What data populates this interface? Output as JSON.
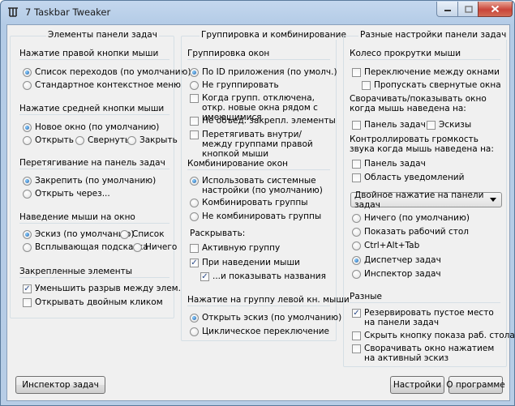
{
  "window": {
    "title": "7 Taskbar Tweaker"
  },
  "col1": {
    "title": "Элементы панели задач",
    "right_click": {
      "label": "Нажатие правой кнопки мыши",
      "opt1": "Список переходов (по умолчанию)",
      "opt2": "Стандартное контекстное меню"
    },
    "middle_click": {
      "label": "Нажатие средней кнопки мыши",
      "opt1": "Новое окно (по умолчанию)",
      "opt2": "Открыть",
      "opt3": "Свернуть",
      "opt4": "Закрыть"
    },
    "drag": {
      "label": "Перетягивание на панель задач",
      "opt1": "Закрепить (по умолчанию)",
      "opt2": "Открыть через..."
    },
    "hover": {
      "label": "Наведение мыши на окно",
      "opt1": "Эскиз (по умолчанию)",
      "opt2": "Список",
      "opt3": "Всплывающая подсказка",
      "opt4": "Ничего"
    },
    "pinned": {
      "label": "Закрепленные элементы",
      "chk1": "Уменьшить разрыв между элем.",
      "chk2": "Открывать двойным кликом"
    }
  },
  "col2": {
    "title": "Группировка и комбинирование",
    "grouping": {
      "label": "Группировка окон",
      "opt1": "По ID приложения (по умолч.)",
      "opt2": "Не группировать",
      "chk1": "Когда групп. отключена, откр. новые окна рядом с имеющимися",
      "chk2": "Не объед. закрепл. элементы",
      "chk3": "Перетягивать внутри/между группами правой кнопкой мыши"
    },
    "combining": {
      "label": "Комбинирование окон",
      "opt1": "Использовать системные настройки (по умолчанию)",
      "opt2": "Комбинировать группы",
      "opt3": "Не комбинировать группы",
      "expand_label": "Раскрывать:",
      "chk1": "Активную группу",
      "chk2": "При наведении мыши",
      "chk3": "...и показывать названия"
    },
    "left_click": {
      "label": "Нажатие на группу левой кн. мыши",
      "opt1": "Открыть эскиз (по умолчанию)",
      "opt2": "Циклическое переключение"
    }
  },
  "col3": {
    "title": "Разные настройки панели задач",
    "wheel": {
      "label": "Колесо прокрутки мыши",
      "chk1": "Переключение между окнами",
      "chk2": "Пропускать свернутые окна"
    },
    "minimize_hover": {
      "label": "Сворачивать/показывать окно когда мышь наведена на:",
      "chk1": "Панель задач",
      "chk2": "Эскизы"
    },
    "volume_hover": {
      "label": "Контроллировать громкость звука когда мышь наведена на:",
      "chk1": "Панель задач",
      "chk2": "Область уведомлений"
    },
    "double_click": {
      "selected": "Двойное нажатие на панели задач",
      "opt1": "Ничего (по умолчанию)",
      "opt2": "Показать рабочий стол",
      "opt3": "Ctrl+Alt+Tab",
      "opt4": "Диспетчер задач",
      "opt5": "Инспектор задач"
    },
    "misc": {
      "label": "Разные",
      "chk1": "Резервировать пустое место на панели задач",
      "chk2": "Скрыть кнопку показа раб. стола",
      "chk3": "Сворачивать окно нажатием на активный эскиз"
    }
  },
  "buttons": {
    "inspector": "Инспектор задач",
    "settings": "Настройки",
    "about": "О программе"
  },
  "colors": {
    "accent": "#1b5ea8",
    "frame": "#b7cde6",
    "close": "#c9453a"
  }
}
